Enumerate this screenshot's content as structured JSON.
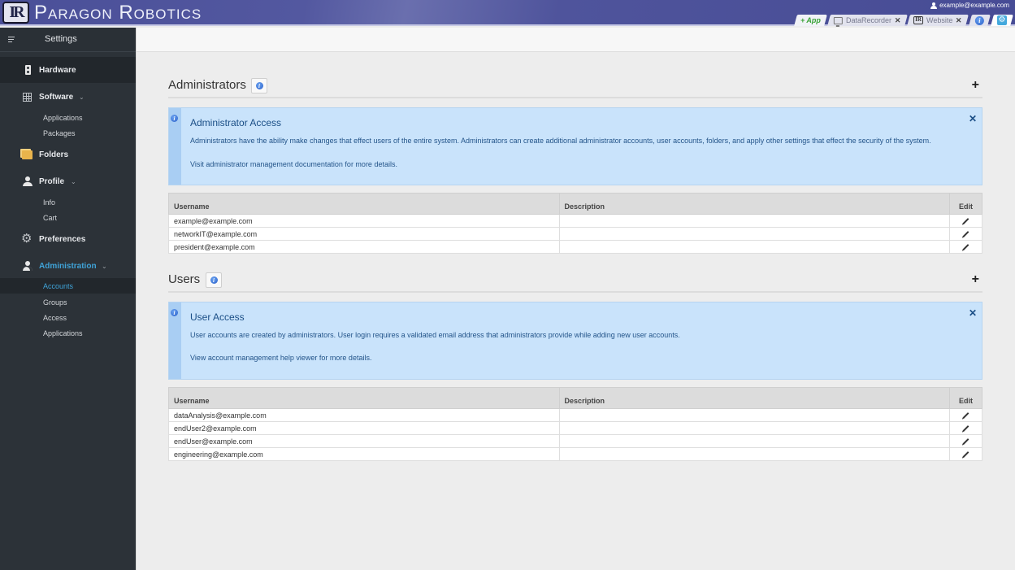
{
  "app": {
    "brand": "Paragon Robotics",
    "logo_text": "IR",
    "user_email": "example@example.com"
  },
  "tabs": [
    {
      "label": "+ App",
      "type": "add"
    },
    {
      "label": "DataRecorder",
      "icon": "monitor-icon",
      "closable": true
    },
    {
      "label": "Website",
      "icon": "ir-logo-icon",
      "closable": true
    },
    {
      "label": "",
      "icon": "info-icon"
    },
    {
      "label": "",
      "icon": "gear-icon",
      "active": true
    }
  ],
  "tab_close_glyph": "✕",
  "sidebar": {
    "title": "Settings",
    "items": [
      {
        "label": "Hardware",
        "icon": "hardware-icon",
        "active": true
      },
      {
        "label": "Software",
        "icon": "grid-icon",
        "expanded": true,
        "children": [
          "Applications",
          "Packages"
        ]
      },
      {
        "label": "Folders",
        "icon": "folder-icon"
      },
      {
        "label": "Profile",
        "icon": "person-icon",
        "expanded": true,
        "children": [
          "Info",
          "Cart"
        ]
      },
      {
        "label": "Preferences",
        "icon": "gear-icon"
      },
      {
        "label": "Administration",
        "icon": "admin-icon",
        "expanded": true,
        "highlighted": true,
        "children": [
          "Accounts",
          "Groups",
          "Access",
          "Applications"
        ],
        "selected_child": "Accounts"
      }
    ]
  },
  "glyphs": {
    "chevron": "⌄",
    "plus": "+",
    "close": "✕",
    "info": "i",
    "gear": "⚙"
  },
  "administrators": {
    "title": "Administrators",
    "alert": {
      "title": "Administrator Access",
      "text": "Administrators have the ability make changes that effect users of the entire system. Administrators can create additional administrator accounts, user accounts, folders, and apply other settings that effect the security of the system.",
      "link_text": "Visit administrator management documentation for more details."
    },
    "columns": [
      "Username",
      "Description",
      "Edit"
    ],
    "rows": [
      {
        "username": "example@example.com",
        "description": ""
      },
      {
        "username": "networkIT@example.com",
        "description": ""
      },
      {
        "username": "president@example.com",
        "description": ""
      }
    ]
  },
  "users": {
    "title": "Users",
    "alert": {
      "title": "User Access",
      "text": "User accounts are created by administrators. User login requires a validated email address that administrators provide while adding new user accounts.",
      "link_text": "View account management help viewer for more details."
    },
    "columns": [
      "Username",
      "Description",
      "Edit"
    ],
    "rows": [
      {
        "username": "dataAnalysis@example.com",
        "description": ""
      },
      {
        "username": "endUser2@example.com",
        "description": ""
      },
      {
        "username": "endUser@example.com",
        "description": ""
      },
      {
        "username": "engineering@example.com",
        "description": ""
      }
    ]
  },
  "colors": {
    "banner": "#4a4f98",
    "sidebar_bg": "#2c3238",
    "accent_blue": "#3fa3d8",
    "alert_bg": "#c9e3fb",
    "alert_text": "#1a4e86"
  }
}
